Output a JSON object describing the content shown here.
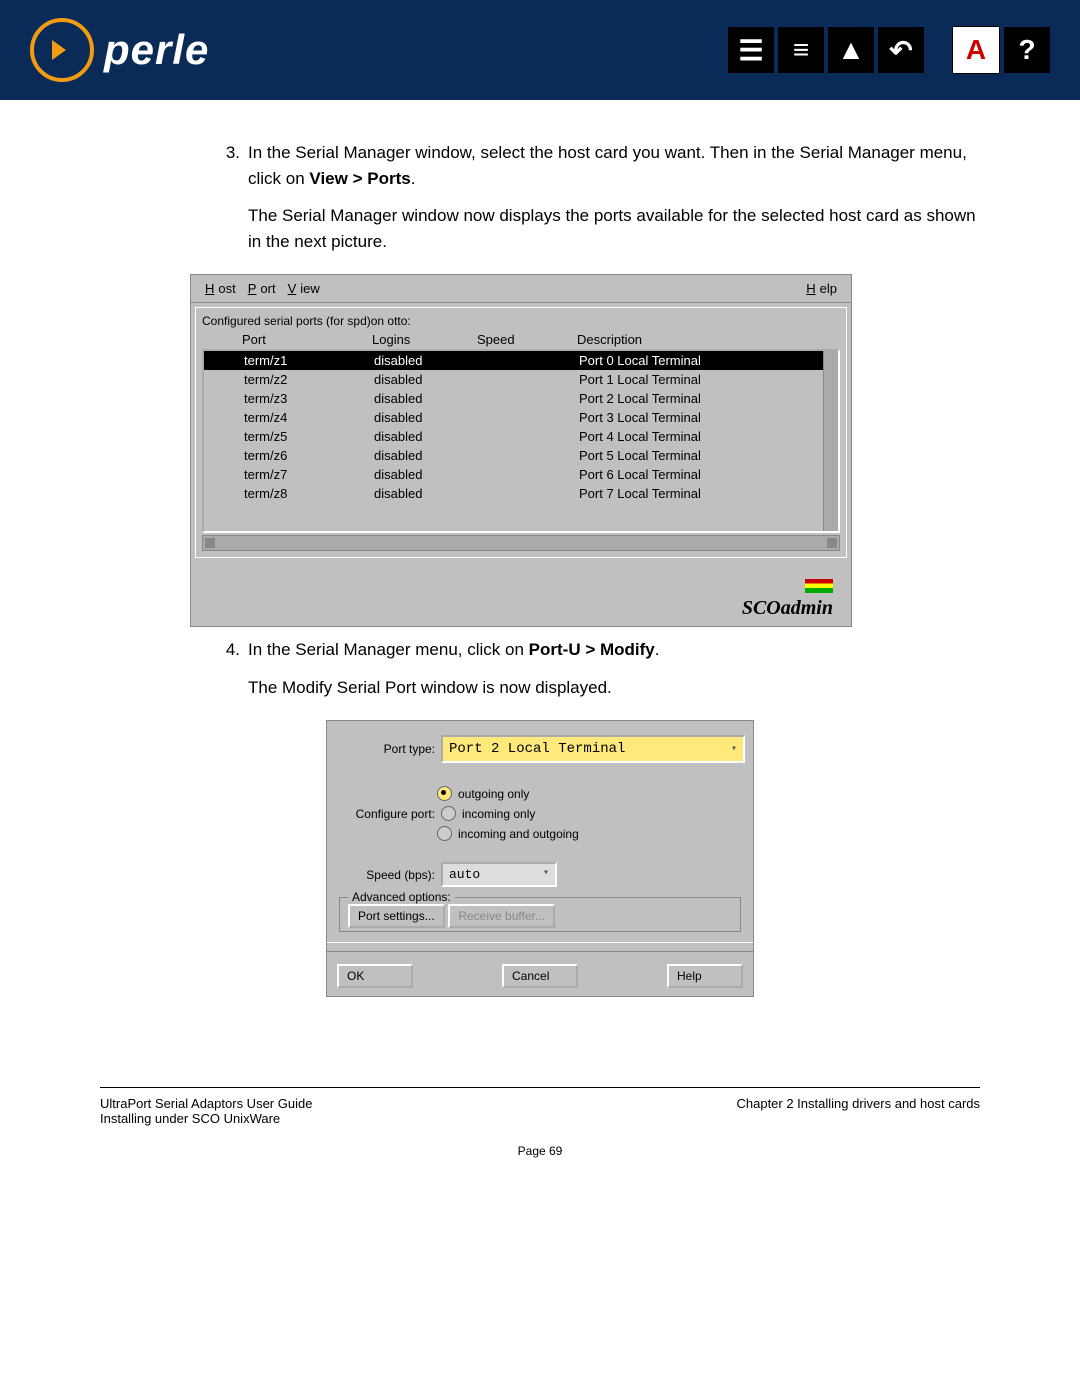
{
  "header": {
    "brand": "perle"
  },
  "steps": {
    "s3_num": "3.",
    "s3_a": "In the Serial Manager window, select the host card you want. Then in the Serial Manager menu, click on ",
    "s3_b": "View > Ports",
    "s3_c": ".",
    "s3_follow": "The Serial Manager window now displays the ports available for the selected host card as shown in the next picture.",
    "s4_num": "4.",
    "s4_a": "In the Serial Manager menu, click on ",
    "s4_b": "Port-U > Modify",
    "s4_c": ".",
    "s4_follow": "The Modify Serial Port window is now displayed."
  },
  "serial_manager": {
    "menu": {
      "host": "Host",
      "port": "Port",
      "view": "View",
      "help": "Help"
    },
    "caption": "Configured serial ports (for spd)on otto:",
    "headers": {
      "port": "Port",
      "logins": "Logins",
      "speed": "Speed",
      "desc": "Description"
    },
    "rows": [
      {
        "port": "term/z1",
        "logins": "disabled",
        "speed": "",
        "desc": "Port 0 Local Terminal",
        "selected": true
      },
      {
        "port": "term/z2",
        "logins": "disabled",
        "speed": "",
        "desc": "Port 1 Local Terminal",
        "selected": false
      },
      {
        "port": "term/z3",
        "logins": "disabled",
        "speed": "",
        "desc": "Port 2 Local Terminal",
        "selected": false
      },
      {
        "port": "term/z4",
        "logins": "disabled",
        "speed": "",
        "desc": "Port 3 Local Terminal",
        "selected": false
      },
      {
        "port": "term/z5",
        "logins": "disabled",
        "speed": "",
        "desc": "Port 4 Local Terminal",
        "selected": false
      },
      {
        "port": "term/z6",
        "logins": "disabled",
        "speed": "",
        "desc": "Port 5 Local Terminal",
        "selected": false
      },
      {
        "port": "term/z7",
        "logins": "disabled",
        "speed": "",
        "desc": "Port 6 Local Terminal",
        "selected": false
      },
      {
        "port": "term/z8",
        "logins": "disabled",
        "speed": "",
        "desc": "Port 7 Local Terminal",
        "selected": false
      }
    ],
    "brand": "SCOadmin"
  },
  "modify": {
    "port_type_label": "Port type:",
    "port_type_value": "Port 2 Local Terminal",
    "configure_label": "Configure port:",
    "radios": {
      "outgoing": "outgoing only",
      "incoming": "incoming only",
      "both": "incoming and outgoing"
    },
    "speed_label": "Speed (bps):",
    "speed_value": "auto",
    "advanced_legend": "Advanced options:",
    "port_settings_btn": "Port settings...",
    "receive_buffer_btn": "Receive buffer...",
    "ok": "OK",
    "cancel": "Cancel",
    "help": "Help"
  },
  "footer": {
    "left": "UltraPort Serial Adaptors User Guide",
    "right": "Chapter 2 Installing drivers and host cards",
    "sub": "Installing under SCO UnixWare",
    "page": "Page 69"
  }
}
